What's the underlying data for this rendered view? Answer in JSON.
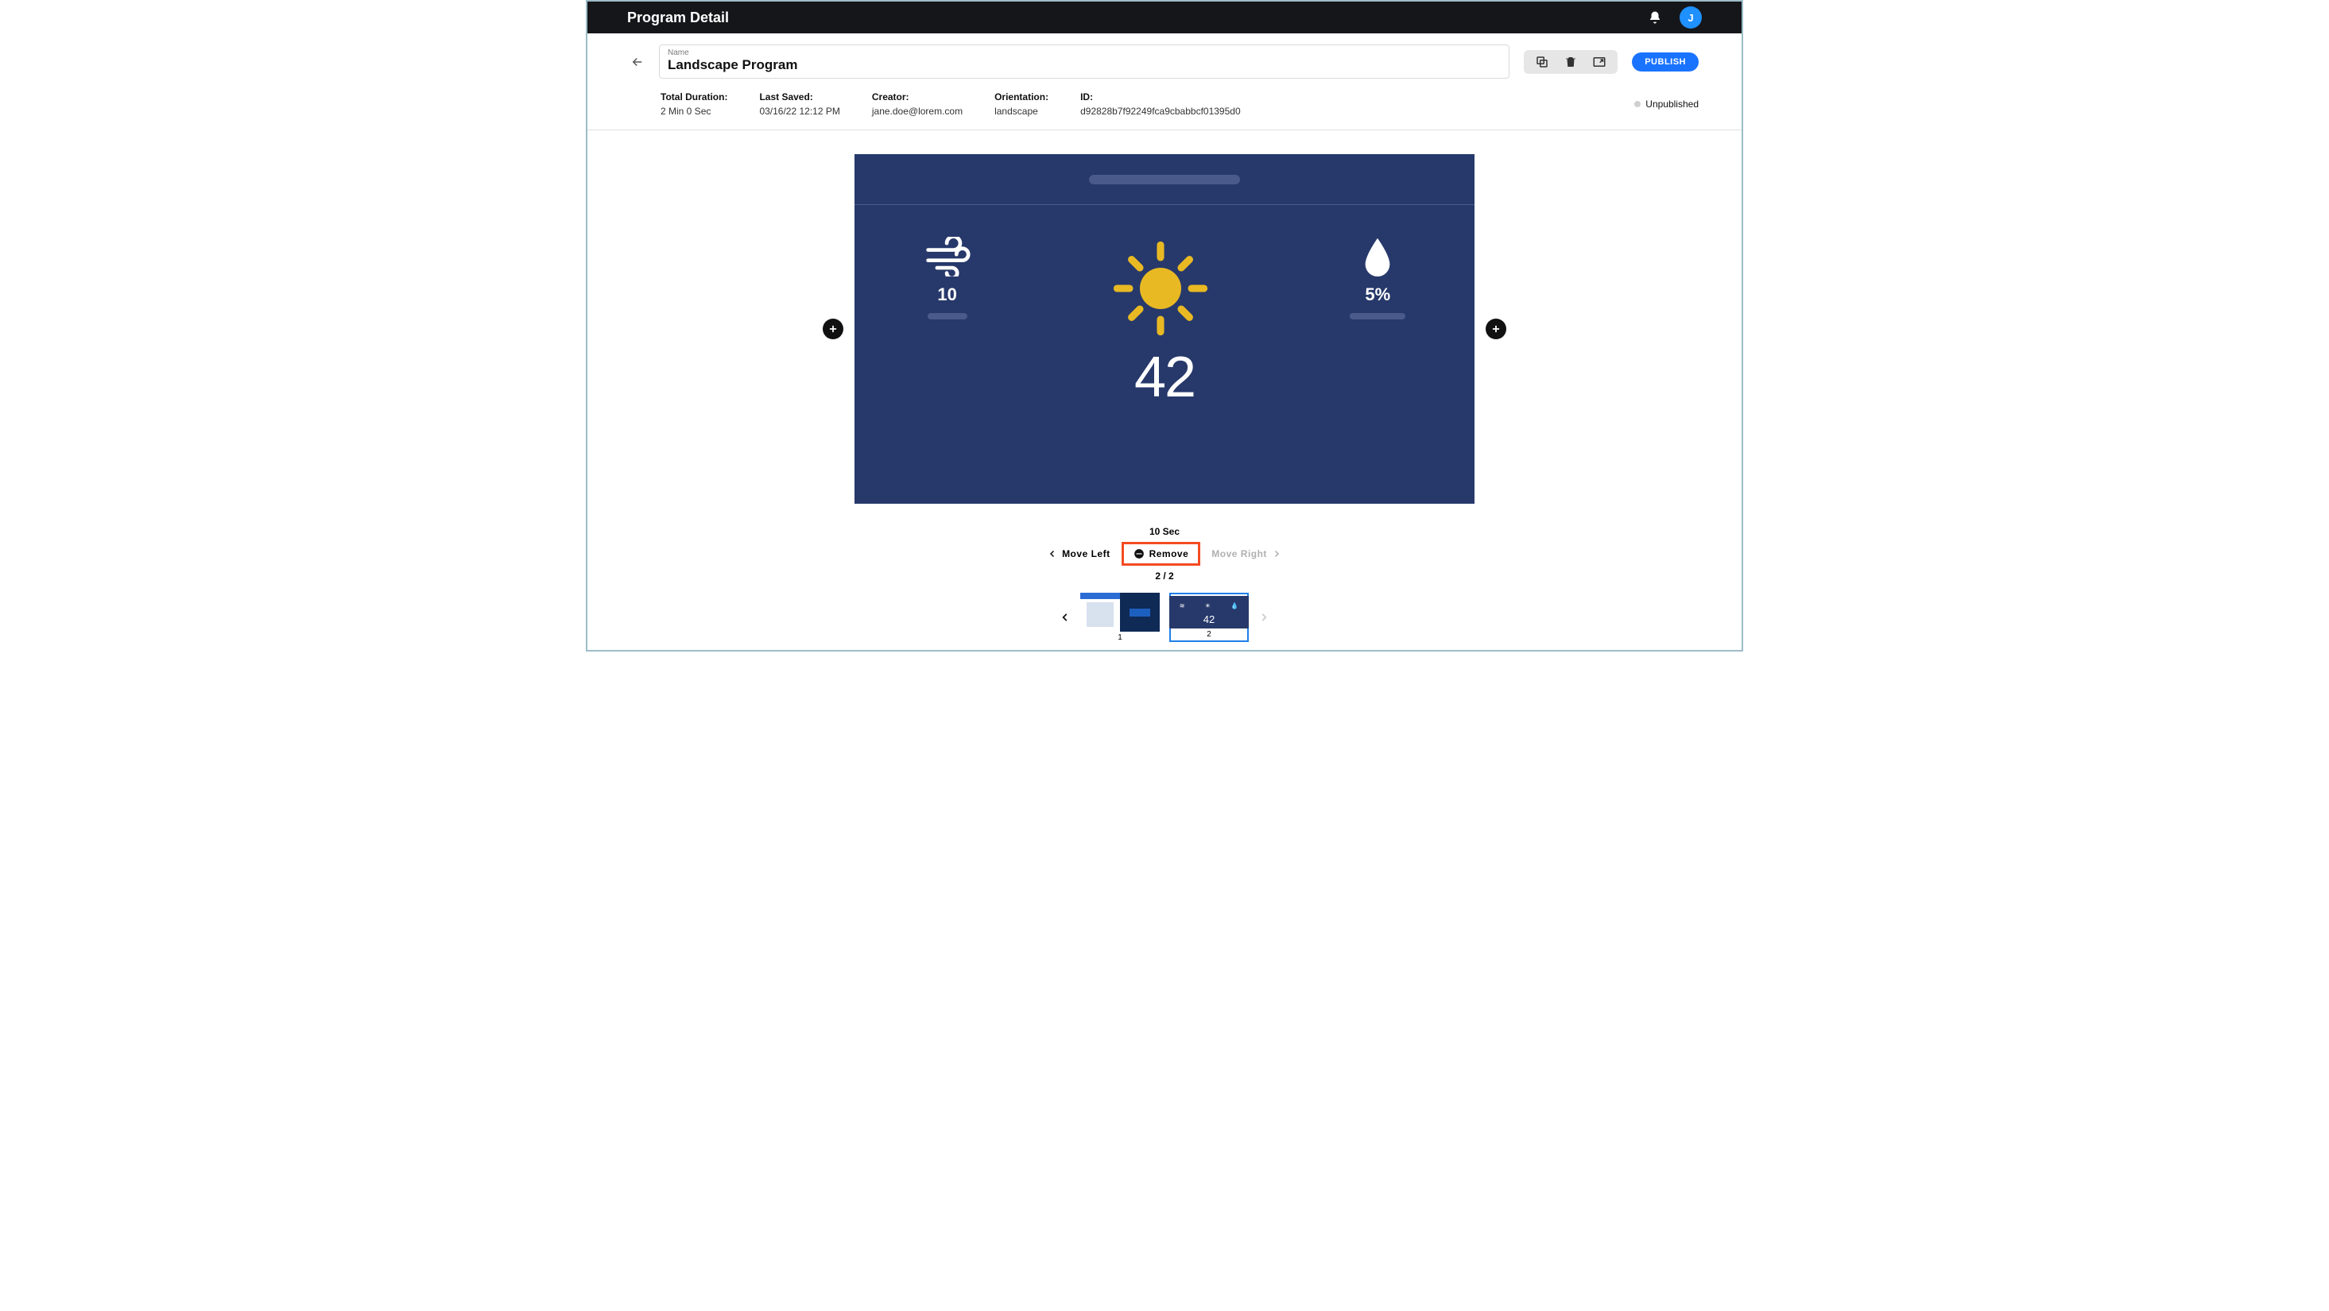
{
  "topbar": {
    "title": "Program Detail",
    "avatar_initial": "J"
  },
  "name_field": {
    "label": "Name",
    "value": "Landscape Program"
  },
  "publish_button": "PUBLISH",
  "meta": {
    "total_duration": {
      "label": "Total Duration:",
      "value": "2 Min 0 Sec"
    },
    "last_saved": {
      "label": "Last Saved:",
      "value": "03/16/22 12:12 PM"
    },
    "creator": {
      "label": "Creator:",
      "value": "jane.doe@lorem.com"
    },
    "orientation": {
      "label": "Orientation:",
      "value": "landscape"
    },
    "id": {
      "label": "ID:",
      "value": "d92828b7f92249fca9cbabbcf01395d0"
    },
    "status": "Unpublished"
  },
  "slide": {
    "wind_value": "10",
    "humidity_value": "5%",
    "temperature": "42"
  },
  "controls": {
    "duration": "10 Sec",
    "move_left": "Move Left",
    "remove": "Remove",
    "move_right": "Move Right",
    "position": "2 / 2"
  },
  "thumbnails": {
    "t1_label": "1",
    "t2_label": "2",
    "t2_temp": "42"
  }
}
